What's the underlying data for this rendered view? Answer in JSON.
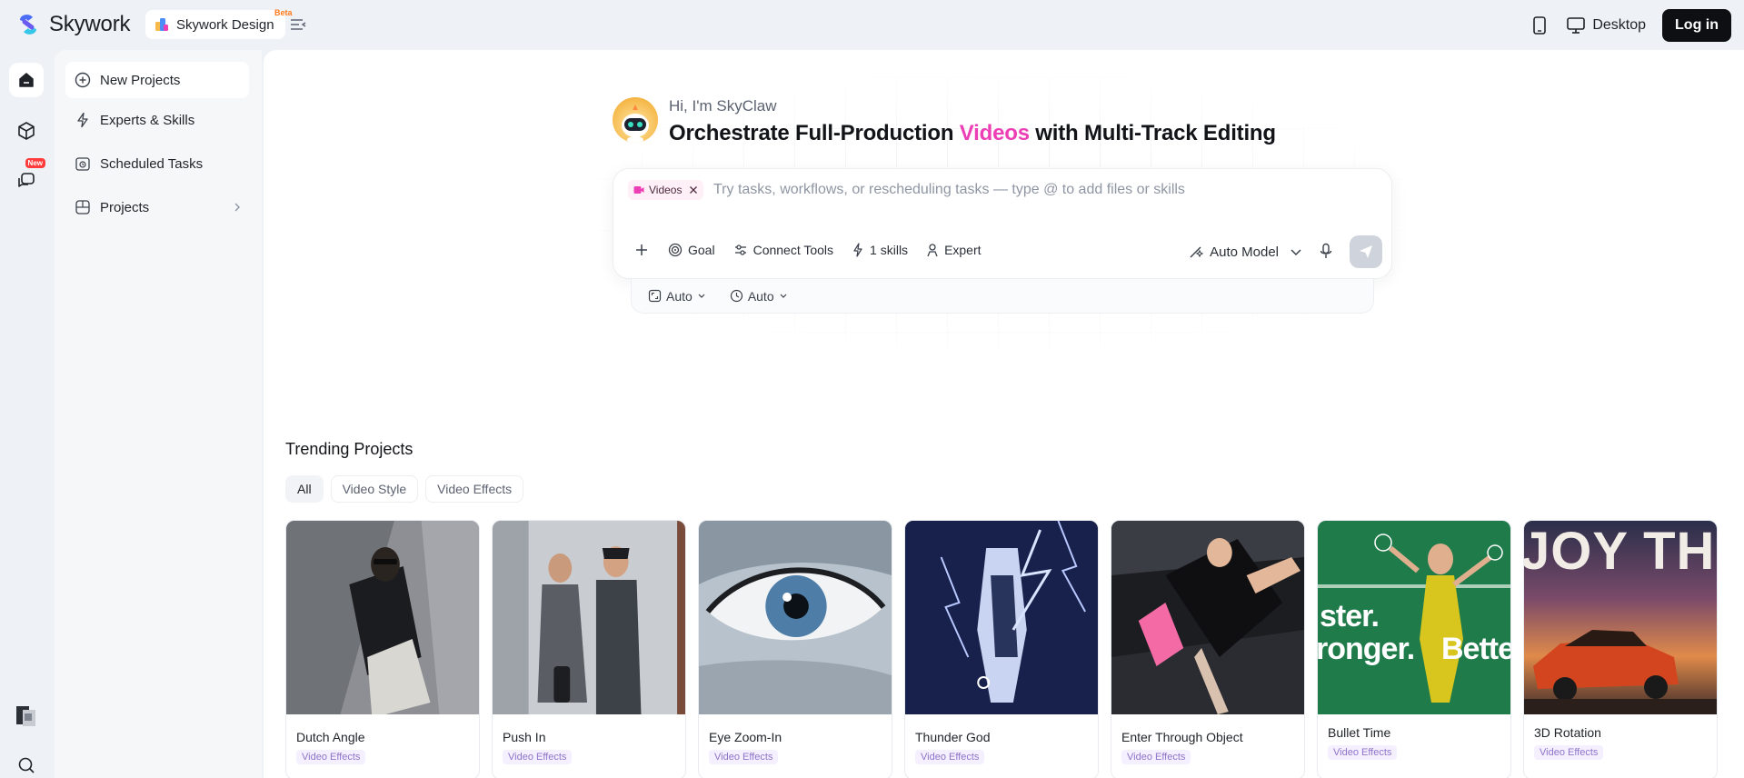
{
  "topbar": {
    "brand": "Skywork",
    "design_label": "Skywork Design",
    "beta": "Beta",
    "desktop_label": "Desktop",
    "login_label": "Log in"
  },
  "rail": {
    "new_badge": "New"
  },
  "sidebar": {
    "items": [
      {
        "label": "New Projects",
        "icon": "plus-circle-icon"
      },
      {
        "label": "Experts & Skills",
        "icon": "lightning-icon"
      },
      {
        "label": "Scheduled Tasks",
        "icon": "calendar-icon"
      },
      {
        "label": "Projects",
        "icon": "folder-icon"
      }
    ]
  },
  "hero": {
    "greeting": "Hi, I'm SkyClaw",
    "headline_pre": "Orchestrate Full-Production ",
    "headline_accent": "Videos",
    "headline_post": " with Multi-Track Editing",
    "accent_color": "#ec3fb6"
  },
  "composer": {
    "chip_label": "Videos",
    "placeholder": "Try tasks, workflows, or rescheduling tasks — type @ to add files or skills",
    "tools": {
      "goal": "Goal",
      "connect": "Connect Tools",
      "skills": "1 skills",
      "expert": "Expert"
    },
    "model": "Auto Model",
    "sub_options": [
      "Auto",
      "Auto"
    ]
  },
  "trending": {
    "title": "Trending Projects",
    "filters": [
      "All",
      "Video Style",
      "Video Effects"
    ],
    "cards": [
      {
        "title": "Dutch Angle",
        "tag": "Video Effects"
      },
      {
        "title": "Push In",
        "tag": "Video Effects"
      },
      {
        "title": "Eye Zoom-In",
        "tag": "Video Effects"
      },
      {
        "title": "Thunder God",
        "tag": "Video Effects"
      },
      {
        "title": "Enter Through Object",
        "tag": "Video Effects"
      },
      {
        "title": "Bullet Time",
        "tag": "Video Effects"
      },
      {
        "title": "3D Rotation",
        "tag": "Video Effects"
      }
    ],
    "thumb_text": {
      "bullet_time": [
        "ster.",
        "ronger.",
        "Better"
      ],
      "rotation": "JOY THE L"
    }
  }
}
